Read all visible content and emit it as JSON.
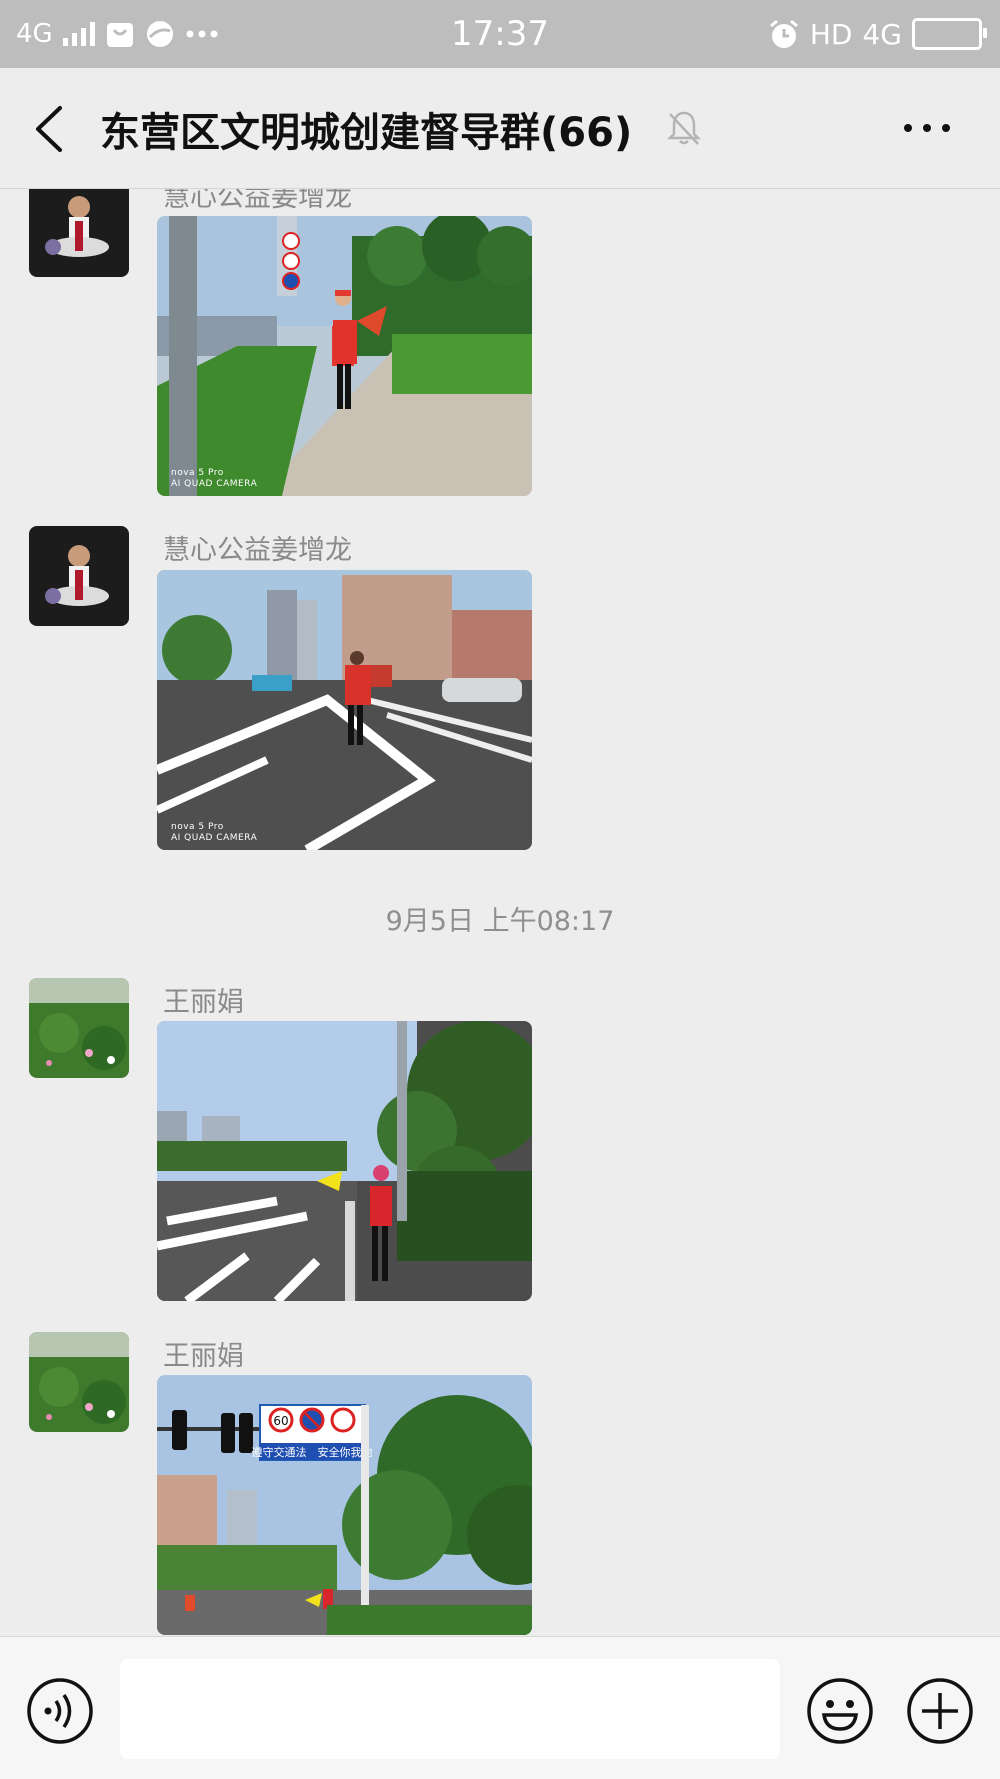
{
  "status_bar": {
    "network_left": "4G",
    "time": "17:37",
    "hd": "HD",
    "network_right": "4G"
  },
  "header": {
    "title": "东营区文明城创建督导群(66)"
  },
  "messages": [
    {
      "sender": "慧心公益姜增龙",
      "watermark": [
        "nova 5 Pro",
        "AI QUAD CAMERA"
      ]
    },
    {
      "sender": "慧心公益姜增龙",
      "watermark": [
        "nova 5 Pro",
        "AI QUAD CAMERA"
      ]
    },
    {
      "sender": "王丽娟"
    },
    {
      "sender": "王丽娟",
      "sign_text": "遵守交通法　安全你我他",
      "speed_limit": "60"
    }
  ],
  "timestamp": "9月5日 上午08:17",
  "input_bar": {
    "text_value": ""
  },
  "icons": [
    "back-icon",
    "mute-icon",
    "more-icon",
    "voice-icon",
    "emoji-icon",
    "plus-icon",
    "alarm-icon",
    "battery-icon"
  ]
}
